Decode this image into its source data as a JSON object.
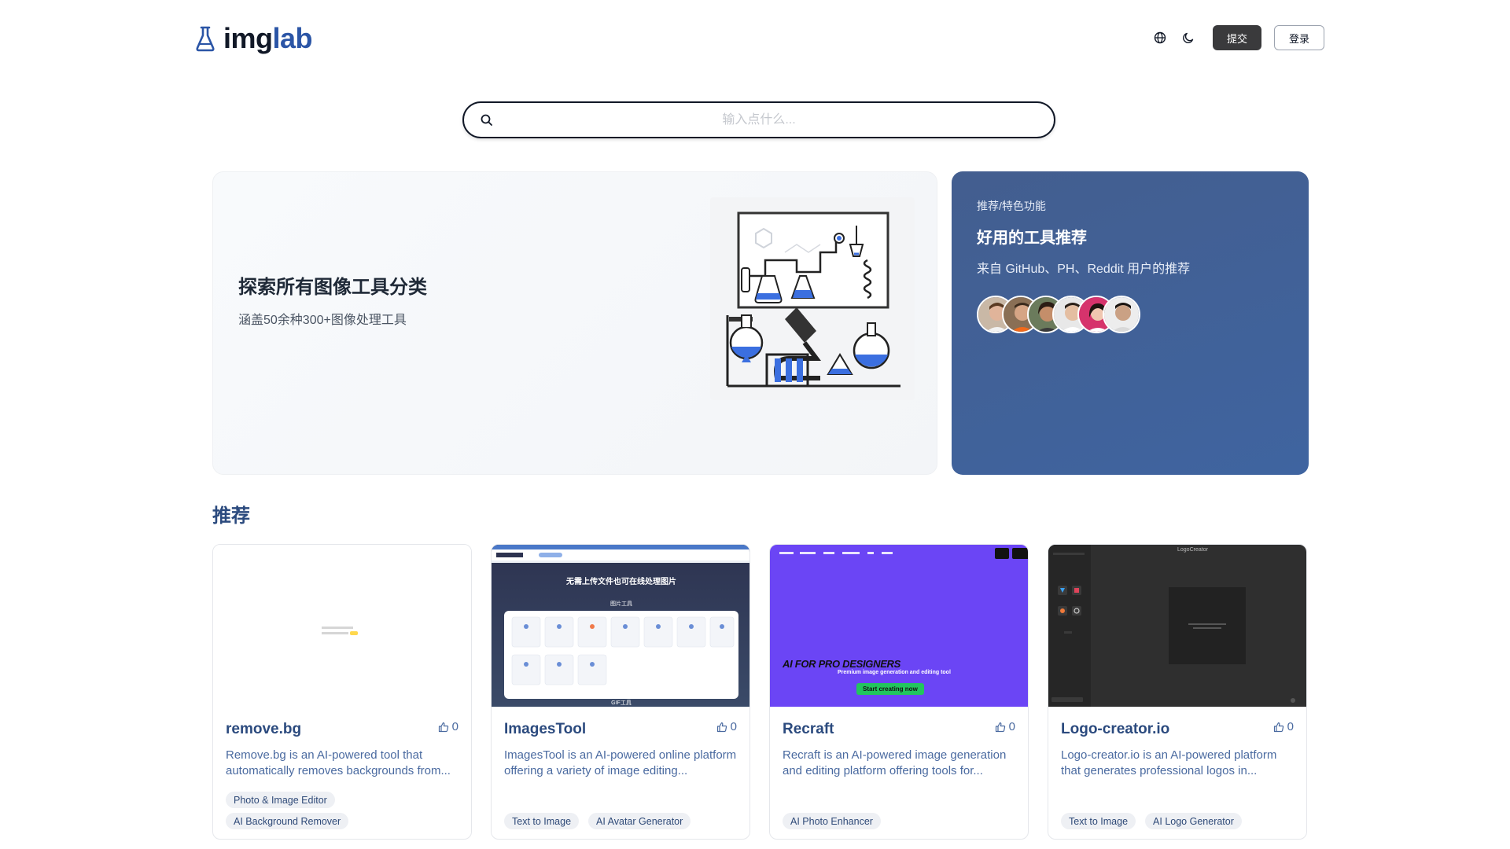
{
  "header": {
    "logo_main": "img",
    "logo_accent": "lab",
    "submit_label": "提交",
    "login_label": "登录"
  },
  "search": {
    "placeholder": "输入点什么..."
  },
  "hero_left": {
    "title": "探索所有图像工具分类",
    "subtitle": "涵盖50余种300+图像处理工具"
  },
  "hero_right": {
    "eyebrow": "推荐/特色功能",
    "title": "好用的工具推荐",
    "description": "来自 GitHub、PH、Reddit 用户的推荐"
  },
  "section": {
    "title": "推荐"
  },
  "cards": [
    {
      "name": "remove.bg",
      "likes": "0",
      "description": "Remove.bg is an AI-powered tool that automatically removes backgrounds from...",
      "tags": [
        "Photo & Image Editor",
        "AI Background Remover"
      ]
    },
    {
      "name": "ImagesTool",
      "likes": "0",
      "description": "ImagesTool is an AI-powered online platform offering a variety of image editing...",
      "tags": [
        "Text to Image",
        "AI Avatar Generator"
      ],
      "thumb_title": "无需上传文件也可在线处理图片",
      "thumb_section": "图片工具",
      "thumb_footer": "GIF工具"
    },
    {
      "name": "Recraft",
      "likes": "0",
      "description": "Recraft is an AI-powered image generation and editing platform offering tools for...",
      "tags": [
        "AI Photo Enhancer"
      ],
      "thumb_headline": "AI FOR PRO DESIGNERS",
      "thumb_sub": "Premium image generation and editing tool",
      "thumb_cta": "Start creating now"
    },
    {
      "name": "Logo-creator.io",
      "likes": "0",
      "description": "Logo-creator.io is an AI-powered platform that generates professional logos in...",
      "tags": [
        "Text to Image",
        "AI Logo Generator"
      ],
      "thumb_brand": "LogoCreator"
    }
  ]
}
